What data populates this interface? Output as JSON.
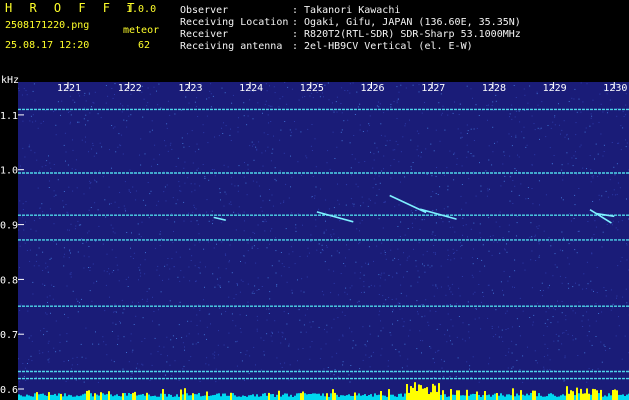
{
  "header": {
    "app_name": "H R O F F T",
    "version": "1.0.0",
    "filename": "2508171220.png",
    "datetime": "25.08.17 12:20",
    "label_meteor": "meteor",
    "meteor_count": "62",
    "info": [
      {
        "key": "Observer",
        "value": ": Takanori Kawachi"
      },
      {
        "key": "Receiving Location",
        "value": ": Ogaki, Gifu, JAPAN (136.60E, 35.35N)"
      },
      {
        "key": "Receiver",
        "value": ": R820T2(RTL-SDR) SDR-Sharp 53.1000MHz"
      },
      {
        "key": "Receiving antenna",
        "value": ": 2el-HB9CV Vertical (el. E-W)"
      }
    ]
  },
  "colors": {
    "background": "#000000",
    "header_text": "#ffff2a",
    "spectrogram_bg": "#1a1c78",
    "signal": "#4fd6e8",
    "histogram": "#00d8f0",
    "histogram_peak": "#ffff00"
  },
  "chart_data": {
    "type": "heatmap",
    "ylabel": "kHz",
    "x_ticks": [
      "1221",
      "1222",
      "1223",
      "1224",
      "1225",
      "1226",
      "1227",
      "1228",
      "1229",
      "1230"
    ],
    "y_ticks": [
      "1.1",
      "1.0",
      "0.9",
      "0.8",
      "0.7",
      "0.6"
    ],
    "ylim": [
      0.58,
      1.16
    ],
    "horizontal_lines_khz": [
      1.11,
      0.994,
      0.917,
      0.872,
      0.751,
      0.632,
      0.619
    ],
    "meteor_echoes": [
      {
        "x": [
          1225.1,
          1225.7
        ],
        "y": [
          0.923,
          0.905
        ]
      },
      {
        "x": [
          1226.3,
          1226.9
        ],
        "y": [
          0.953,
          0.922
        ]
      },
      {
        "x": [
          1226.8,
          1227.4
        ],
        "y": [
          0.928,
          0.91
        ]
      },
      {
        "x": [
          1223.4,
          1223.6
        ],
        "y": [
          0.913,
          0.908
        ]
      },
      {
        "x": [
          1229.6,
          1229.95
        ],
        "y": [
          0.927,
          0.903
        ]
      },
      {
        "x": [
          1229.7,
          1230.0
        ],
        "y": [
          0.92,
          0.915
        ]
      }
    ]
  }
}
